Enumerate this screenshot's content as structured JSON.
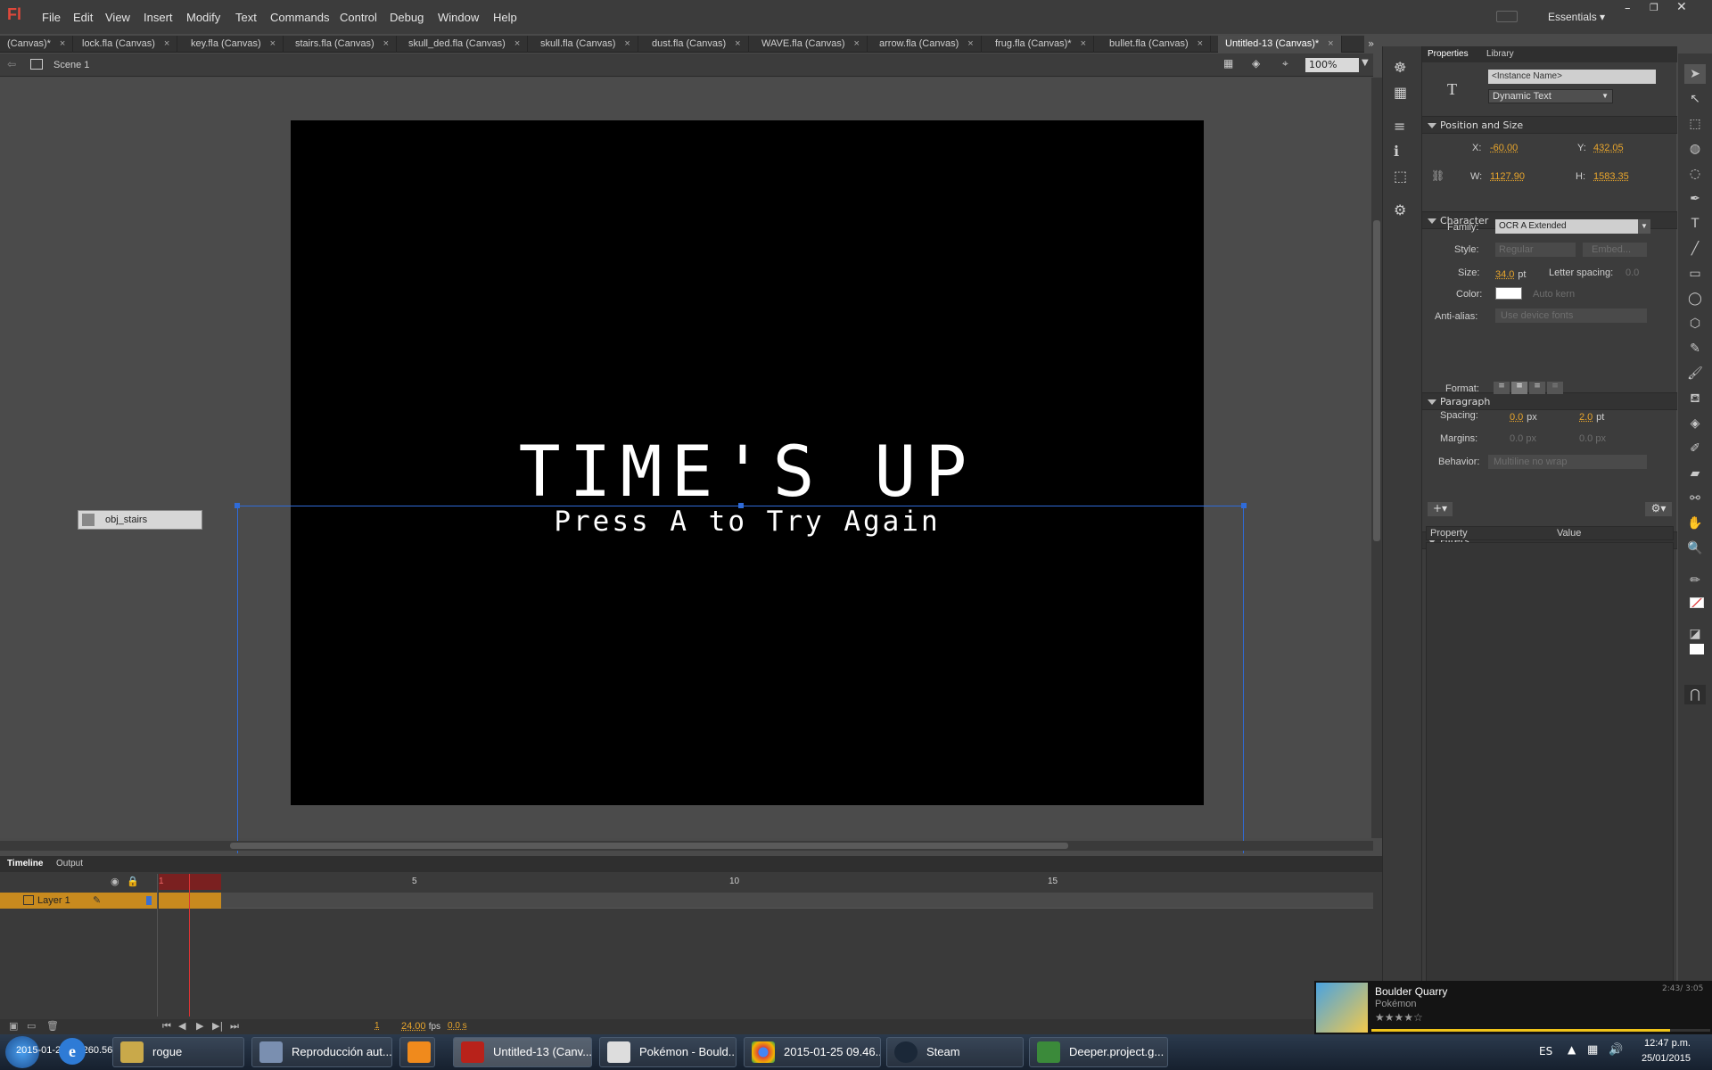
{
  "app": {
    "logo": "Fl",
    "workspace": "Essentials"
  },
  "menu": [
    "File",
    "Edit",
    "View",
    "Insert",
    "Modify",
    "Text",
    "Commands",
    "Control",
    "Debug",
    "Window",
    "Help"
  ],
  "tabs": [
    {
      "label": "(Canvas)*"
    },
    {
      "label": "lock.fla (Canvas)"
    },
    {
      "label": "key.fla (Canvas)"
    },
    {
      "label": "stairs.fla (Canvas)"
    },
    {
      "label": "skull_ded.fla (Canvas)"
    },
    {
      "label": "skull.fla (Canvas)"
    },
    {
      "label": "dust.fla (Canvas)"
    },
    {
      "label": "WAVE.fla (Canvas)"
    },
    {
      "label": "arrow.fla (Canvas)"
    },
    {
      "label": "frug.fla (Canvas)*"
    },
    {
      "label": "bullet.fla (Canvas)"
    },
    {
      "label": "Untitled-13 (Canvas)*"
    }
  ],
  "scene": {
    "label": "Scene 1",
    "zoom": "100%"
  },
  "stage": {
    "title": "TIME'S UP",
    "subtitle": "Press A to Try Again",
    "label_box": "obj_stairs",
    "bg": "#000000",
    "selection_color": "#2f6bd8"
  },
  "timeline": {
    "tabs": [
      "Timeline",
      "Output"
    ],
    "layer": "Layer 1",
    "frame_numbers": [
      "1",
      "5",
      "10",
      "15"
    ],
    "current_frame": "1",
    "fps": "24.00",
    "fps_unit": "fps",
    "time": "0.0 s"
  },
  "properties": {
    "tabs": [
      "Properties",
      "Library"
    ],
    "instance_placeholder": "<Instance Name>",
    "text_type": "Dynamic Text",
    "sections": {
      "position": "Position and Size",
      "character": "Character",
      "paragraph": "Paragraph",
      "filters": "Filters"
    },
    "x_label": "X:",
    "x": "-60.00",
    "y_label": "Y:",
    "y": "432.05",
    "w_label": "W:",
    "w": "1127.90",
    "h_label": "H:",
    "h": "1583.35",
    "family_label": "Family:",
    "family": "OCR A Extended",
    "style_label": "Style:",
    "style": "Regular",
    "embed": "Embed...",
    "size_label": "Size:",
    "size": "34.0",
    "size_unit": "pt",
    "letter_spacing_label": "Letter spacing:",
    "letter_spacing": "0.0",
    "color_label": "Color:",
    "auto_kern": "Auto kern",
    "color": "#ffffff",
    "antialias_label": "Anti-alias:",
    "antialias": "Use device fonts",
    "format_label": "Format:",
    "spacing_label": "Spacing:",
    "indent": "0.0",
    "indent_unit": "px",
    "line_spacing": "2.0",
    "line_unit": "pt",
    "margins_label": "Margins:",
    "margin_left": "0.0 px",
    "margin_right": "0.0 px",
    "behavior_label": "Behavior:",
    "behavior": "Multiline no wrap",
    "table_headers": [
      "Property",
      "Value"
    ]
  },
  "taskbar": {
    "items": [
      {
        "label": "rogue"
      },
      {
        "label": "Reproducción aut..."
      },
      {
        "label": ""
      },
      {
        "label": "Untitled-13 (Canv..."
      },
      {
        "label": "Pokémon - Bould..."
      },
      {
        "label": "2015-01-25 09.46...."
      },
      {
        "label": "Steam"
      },
      {
        "label": "Deeper.project.g..."
      }
    ],
    "overlay_text": "2015-01-25 07.260.56",
    "lang": "ES",
    "time": "12:47 p.m.",
    "date": "25/01/2015"
  },
  "media": {
    "title": "Boulder Quarry",
    "artist": "Pokémon",
    "time": "2:43/ 3:05",
    "rating": 4
  }
}
